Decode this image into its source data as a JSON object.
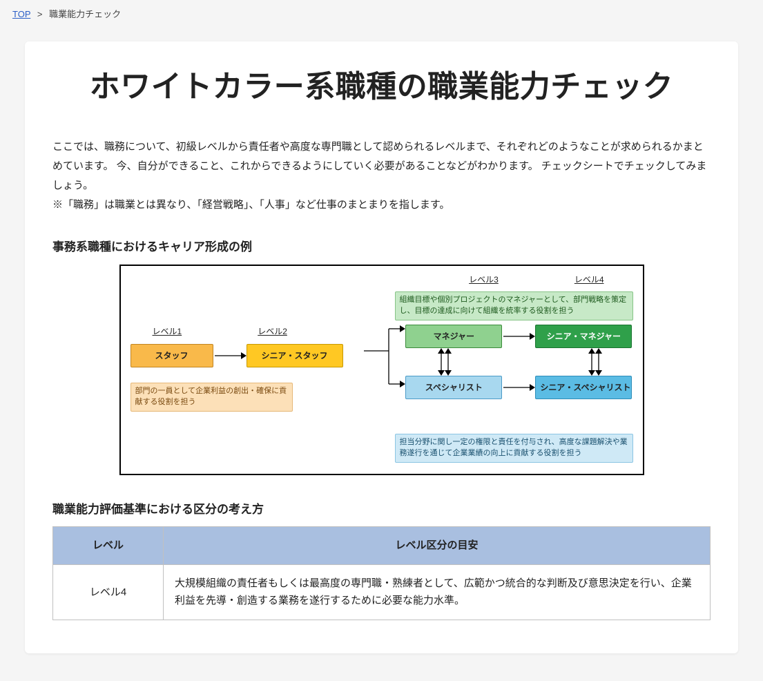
{
  "breadcrumb": {
    "top": "TOP",
    "sep": ">",
    "current": "職業能力チェック"
  },
  "title": "ホワイトカラー系職種の職業能力チェック",
  "intro": [
    "ここでは、職務について、初級レベルから責任者や高度な専門職として認められるレベルまで、それぞれどのようなことが求められるかまとめています。 今、自分ができること、これからできるようにしていく必要があることなどがわかります。 チェックシートでチェックしてみましょう。",
    "※「職務」は職業とは異なり、「経営戦略」、「人事」など仕事のまとまりを指します。"
  ],
  "diagram_heading": "事務系職種におけるキャリア形成の例",
  "diagram": {
    "levels": {
      "l1": "レベル1",
      "l2": "レベル2",
      "l3": "レベル3",
      "l4": "レベル4"
    },
    "staff": "スタッフ",
    "senior_staff": "シニア・スタッフ",
    "manager": "マネジャー",
    "senior_manager": "シニア・マネジャー",
    "specialist": "スペシャリスト",
    "senior_specialist": "シニア・スペシャリスト",
    "note_left": "部門の一員として企業利益の創出・確保に貢献する役割を担う",
    "note_top": "組織目標や個別プロジェクトのマネジャーとして、部門戦略を策定し、目標の達成に向けて組織を統率する役割を担う",
    "note_bottom": "担当分野に関し一定の権限と責任を付与され、高度な課題解決や業務遂行を通じて企業業績の向上に貢献する役割を担う"
  },
  "table_heading": "職業能力評価基準における区分の考え方",
  "table": {
    "h1": "レベル",
    "h2": "レベル区分の目安",
    "rows": [
      {
        "lv": "レベル4",
        "desc": "大規模組織の責任者もしくは最高度の専門職・熟練者として、広範かつ統合的な判断及び意思決定を行い、企業利益を先導・創造する業務を遂行するために必要な能力水準。"
      }
    ]
  }
}
